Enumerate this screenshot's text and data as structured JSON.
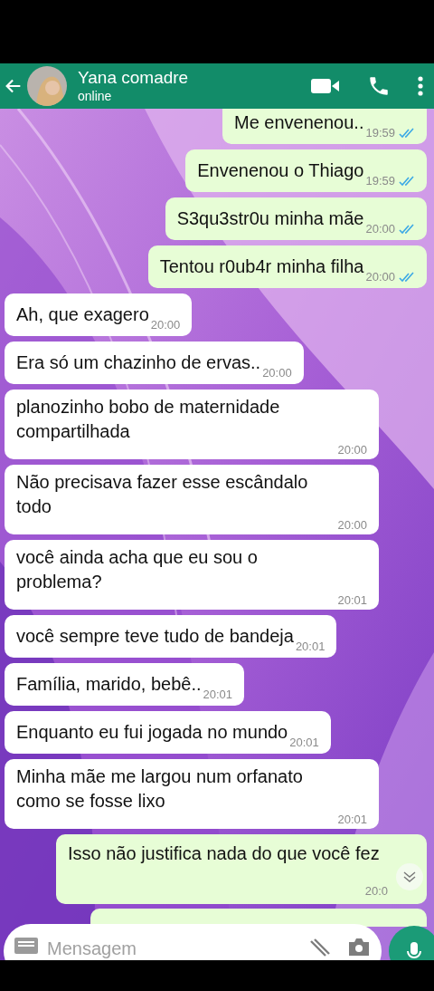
{
  "header": {
    "name": "Yana comadre",
    "status": "online"
  },
  "messages": [
    {
      "kind": "outgoing",
      "text": "Me envenenou..",
      "time": "19:59",
      "read": true
    },
    {
      "kind": "outgoing",
      "text": "Envenenou o Thiago",
      "time": "19:59",
      "read": true
    },
    {
      "kind": "outgoing",
      "text": "S3qu3str0u minha mãe",
      "time": "20:00",
      "read": true
    },
    {
      "kind": "outgoing",
      "text": "Tentou r0ub4r minha filha",
      "time": "20:00",
      "read": true
    },
    {
      "kind": "incoming",
      "text": "Ah, que exagero",
      "time": "20:00"
    },
    {
      "kind": "incoming",
      "text": "Era só um chazinho de ervas..",
      "time": "20:00"
    },
    {
      "kind": "incoming",
      "text": "planozinho bobo de maternidade compartilhada",
      "time": "20:00"
    },
    {
      "kind": "incoming",
      "text": "Não precisava fazer esse escândalo todo",
      "time": "20:00"
    },
    {
      "kind": "incoming",
      "text": "você ainda acha que eu sou o problema?",
      "time": "20:01"
    },
    {
      "kind": "incoming",
      "text": "você sempre teve tudo de bandeja",
      "time": "20:01"
    },
    {
      "kind": "incoming",
      "text": "Família, marido, bebê..",
      "time": "20:01"
    },
    {
      "kind": "incoming",
      "text": "Enquanto eu fui jogada no mundo",
      "time": "20:01"
    },
    {
      "kind": "incoming",
      "text": "Minha mãe me largou num orfanato como se fosse lixo",
      "time": "20:01"
    },
    {
      "kind": "outgoing",
      "text": "Isso não justifica nada do que você fez",
      "time": "20:0"
    }
  ],
  "composer": {
    "placeholder": "Mensagem"
  }
}
